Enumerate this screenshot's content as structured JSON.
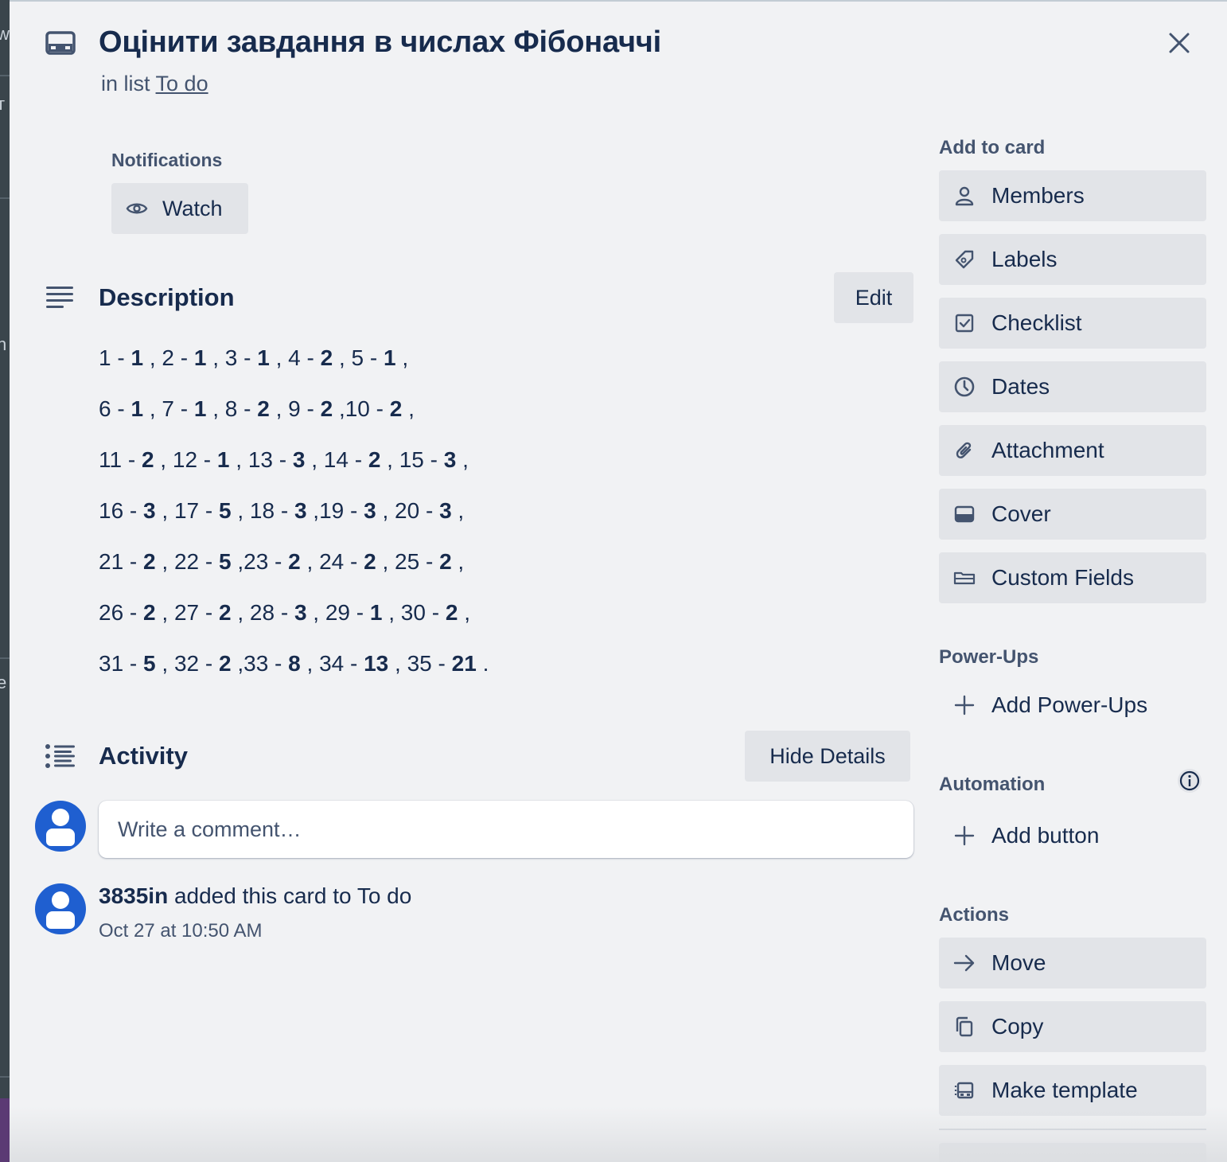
{
  "background": {
    "fragments": [
      "w",
      "т",
      "n",
      "e",
      "e"
    ]
  },
  "card": {
    "title": "Оцінити завдання в числах Фібоначчі",
    "in_list_prefix": "in list",
    "list_name": "To do"
  },
  "notifications": {
    "label": "Notifications",
    "watch_label": "Watch"
  },
  "description": {
    "title": "Description",
    "edit_label": "Edit",
    "lines": [
      [
        [
          "1 - ",
          "1"
        ],
        [
          " , 2 - ",
          "1"
        ],
        [
          " , 3 - ",
          "1"
        ],
        [
          " , 4 - ",
          "2"
        ],
        [
          " , 5 - ",
          "1"
        ],
        [
          " ,",
          ""
        ]
      ],
      [
        [
          "6 - ",
          "1"
        ],
        [
          " , 7 - ",
          "1"
        ],
        [
          " , 8 - ",
          "2"
        ],
        [
          " , 9 - ",
          "2"
        ],
        [
          " ,10 - ",
          "2"
        ],
        [
          " ,",
          ""
        ]
      ],
      [
        [
          "11 - ",
          "2"
        ],
        [
          " , 12 - ",
          "1"
        ],
        [
          " , 13 - ",
          "3"
        ],
        [
          " , 14 - ",
          "2"
        ],
        [
          " , 15 - ",
          "3"
        ],
        [
          " ,",
          ""
        ]
      ],
      [
        [
          "16 - ",
          "3"
        ],
        [
          " , 17 - ",
          "5"
        ],
        [
          " , 18 - ",
          "3"
        ],
        [
          " ,19 - ",
          "3"
        ],
        [
          " , 20 - ",
          "3"
        ],
        [
          " ,",
          ""
        ]
      ],
      [
        [
          "21 - ",
          "2"
        ],
        [
          " , 22 - ",
          "5"
        ],
        [
          " ,23 - ",
          "2"
        ],
        [
          " , 24 - ",
          "2"
        ],
        [
          " , 25 - ",
          "2"
        ],
        [
          " ,",
          ""
        ]
      ],
      [
        [
          "26 - ",
          "2"
        ],
        [
          " , 27 - ",
          "2"
        ],
        [
          " , 28 - ",
          "3"
        ],
        [
          " , 29 - ",
          "1"
        ],
        [
          " , 30 - ",
          "2"
        ],
        [
          " ,",
          ""
        ]
      ],
      [
        [
          "31 - ",
          "5"
        ],
        [
          " , 32 - ",
          "2"
        ],
        [
          " ,33 - ",
          "8"
        ],
        [
          " , 34 - ",
          "13"
        ],
        [
          " , 35 - ",
          "21"
        ],
        [
          " .",
          ""
        ]
      ]
    ]
  },
  "activity": {
    "title": "Activity",
    "hide_details_label": "Hide Details",
    "comment_placeholder": "Write a comment…",
    "entries": [
      {
        "user": "3835in",
        "text": " added this card to To do",
        "time": "Oct 27 at 10:50 AM"
      }
    ]
  },
  "sidebar": {
    "add_to_card_label": "Add to card",
    "add_to_card": [
      {
        "label": "Members",
        "icon": "person-icon"
      },
      {
        "label": "Labels",
        "icon": "tag-icon"
      },
      {
        "label": "Checklist",
        "icon": "checkbox-icon"
      },
      {
        "label": "Dates",
        "icon": "clock-icon"
      },
      {
        "label": "Attachment",
        "icon": "paperclip-icon"
      },
      {
        "label": "Cover",
        "icon": "cover-icon"
      },
      {
        "label": "Custom Fields",
        "icon": "field-icon"
      }
    ],
    "powerups_label": "Power-Ups",
    "add_powerups_label": "Add Power-Ups",
    "automation_label": "Automation",
    "add_button_label": "Add button",
    "actions_label": "Actions",
    "actions": [
      {
        "label": "Move",
        "icon": "arrow-right-icon"
      },
      {
        "label": "Copy",
        "icon": "copy-icon"
      },
      {
        "label": "Make template",
        "icon": "template-icon"
      }
    ]
  },
  "colors": {
    "modal_bg": "#f1f2f4",
    "button_bg": "#e2e4e8",
    "text": "#172b4d",
    "subtle_text": "#44546f",
    "avatar": "#1f5fd0"
  }
}
